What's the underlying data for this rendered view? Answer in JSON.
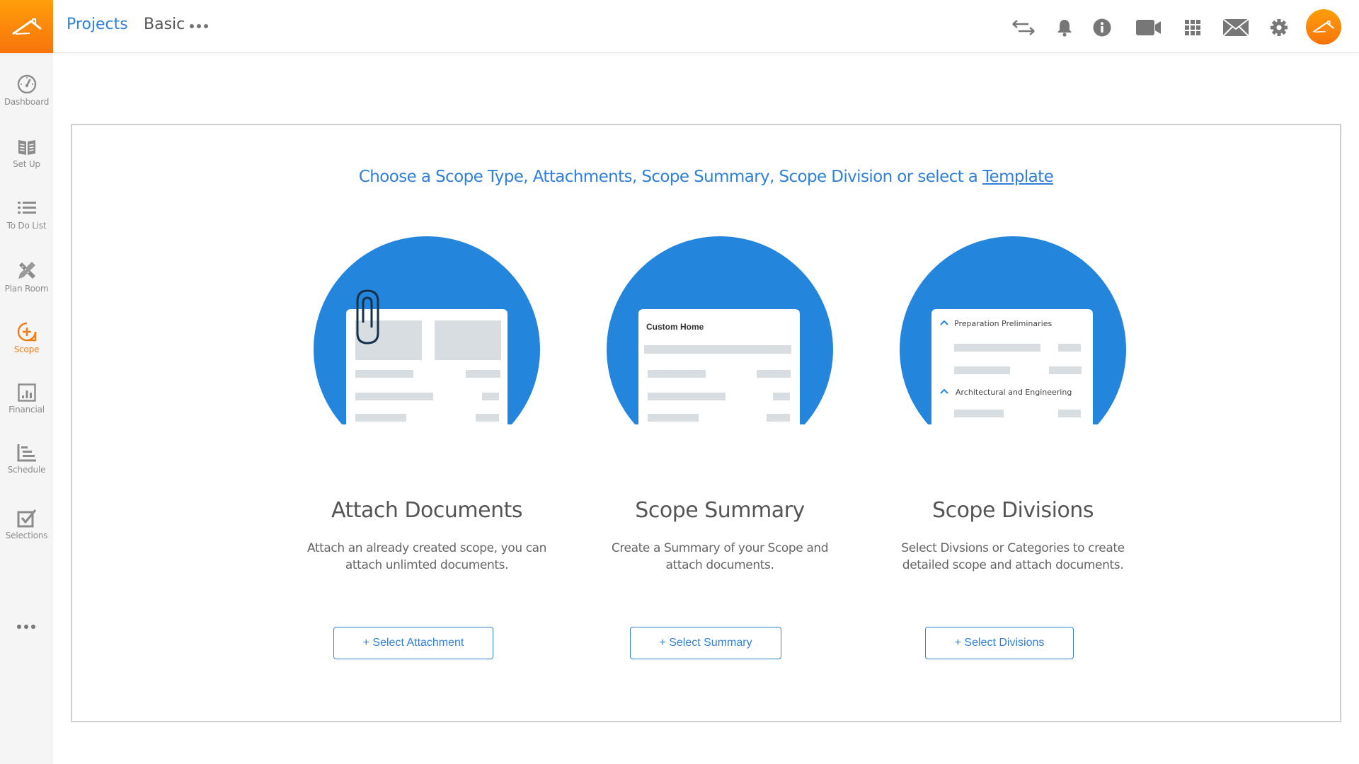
{
  "header": {
    "logo": "buildertrend-house-logo",
    "breadcrumb_projects": "Projects",
    "breadcrumb_current": "Basic",
    "more_menu_icon": "ellipsis-icon",
    "icons": [
      "swap-arrows-icon",
      "bell-icon",
      "info-icon",
      "video-camera-icon",
      "grid-apps-icon",
      "envelope-icon",
      "gear-icon"
    ],
    "avatar": "user-avatar"
  },
  "sidebar": {
    "items": [
      {
        "label": "Dashboard",
        "icon": "gauge-icon",
        "active": false
      },
      {
        "label": "Set Up",
        "icon": "open-book-icon",
        "active": false
      },
      {
        "label": "To Do List",
        "icon": "list-icon",
        "active": false
      },
      {
        "label": "Plan Room",
        "icon": "ruler-pencil-icon",
        "active": false
      },
      {
        "label": "Scope",
        "icon": "plus-circle-icon",
        "active": true
      },
      {
        "label": "Financial",
        "icon": "bar-chart-icon",
        "active": false
      },
      {
        "label": "Schedule",
        "icon": "gantt-icon",
        "active": false
      },
      {
        "label": "Selections",
        "icon": "checkbox-icon",
        "active": false
      }
    ],
    "more_icon": "ellipsis-icon"
  },
  "main": {
    "intro_text": "Choose a Scope Type, Attachments, Scope Summary, Scope Division or select a ",
    "intro_link": "Template",
    "cards": [
      {
        "title": "Attach Documents",
        "description_line1": "Attach an already created scope, you can",
        "description_line2": "attach unlimted documents.",
        "button": "+ Select Attachment",
        "illustration": "paperclip-document"
      },
      {
        "title": "Scope Summary",
        "description_line1": "Create a Summary of your Scope and",
        "description_line2": "attach documents.",
        "button": "+ Select Summary",
        "illustration": "summary-document",
        "illustration_heading": "Custom Home"
      },
      {
        "title": "Scope Divisions",
        "description_line1": "Select Divsions or Categories to create",
        "description_line2": "detailed scope and attach documents.",
        "button": "+ Select Divisions",
        "illustration": "divisions-document",
        "illustration_division_1": "Preparation Preliminaries",
        "illustration_division_2": "Architectural and Engineering"
      }
    ]
  },
  "colors": {
    "brand_orange": "#f7740c",
    "accent_blue": "#2f80d9",
    "circle_blue": "#2385dc",
    "placeholder_gray": "#d8dde1"
  }
}
